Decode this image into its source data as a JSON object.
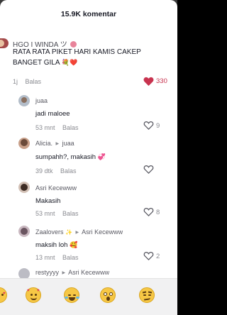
{
  "header": {
    "title": "15.9K komentar"
  },
  "main_comment": {
    "username": "HGO I WINDA",
    "username_suffix": "ツ",
    "text_line1": "RATA RATA PIKET HARI KAMIS CAKEP",
    "text_line2": "BANGET GILA",
    "text_emoji": "💐❤️",
    "time": "1j",
    "reply_label": "Balas",
    "likes": "330",
    "liked": true
  },
  "replies": [
    {
      "username": "juaa",
      "reply_to": "",
      "text": "jadi maloee",
      "time": "53 mnt",
      "reply_label": "Balas",
      "likes": "9"
    },
    {
      "username": "Alicia.",
      "reply_to": "juaa",
      "text": "sumpahh?, makasih",
      "text_emoji": "💞",
      "time": "39 dtk",
      "reply_label": "Balas",
      "likes": ""
    },
    {
      "username": "Asri Kecewww",
      "reply_to": "",
      "text": "Makasih",
      "time": "53 mnt",
      "reply_label": "Balas",
      "likes": "8"
    },
    {
      "username": "Zaalovers",
      "username_suffix": "✨",
      "reply_to": "Asri Kecewww",
      "text": "maksih loh",
      "text_emoji": "🥰",
      "time": "13 mnt",
      "reply_label": "Balas",
      "likes": "2"
    },
    {
      "username": "restyyyy",
      "reply_to": "Asri Kecewww",
      "text": "",
      "time": "",
      "reply_label": "",
      "likes": ""
    }
  ],
  "emoji_bar": [
    "smiling-hearts",
    "smiling-hearts",
    "tears-of-joy",
    "astonished",
    "smirking"
  ],
  "colors": {
    "liked_heart": "#c8334f",
    "secondary_text": "#8a8b91",
    "panel_bg": "#ffffff",
    "emoji_bar_bg": "#f1f1f2"
  }
}
